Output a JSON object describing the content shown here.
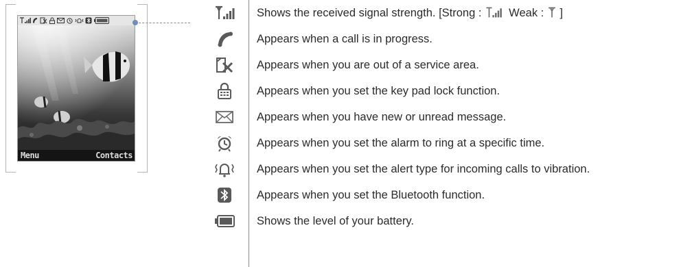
{
  "phone": {
    "softkey_left": "Menu",
    "softkey_right": "Contacts",
    "status_icons": [
      "signal-icon",
      "call-icon",
      "no-service-icon",
      "keypad-lock-icon",
      "message-icon",
      "alarm-icon",
      "vibration-icon",
      "bluetooth-icon",
      "battery-icon"
    ]
  },
  "rows": [
    {
      "icon": "signal-strength-icon",
      "before": "Shows the received signal strength. [Strong : ",
      "middle": "  Weak : ",
      "after": " ]"
    },
    {
      "icon": "call-in-progress-icon",
      "text": "Appears when a call is in progress."
    },
    {
      "icon": "no-service-icon",
      "text": "Appears when you are out of a service area."
    },
    {
      "icon": "keypad-lock-icon",
      "text": "Appears when you set the key pad lock function."
    },
    {
      "icon": "message-envelope-icon",
      "text": "Appears when you have new or unread message."
    },
    {
      "icon": "alarm-clock-icon",
      "text": "Appears when you set the alarm to ring at a specific time."
    },
    {
      "icon": "vibration-icon",
      "text": "Appears when you set the alert type for incoming calls to vibration."
    },
    {
      "icon": "bluetooth-icon",
      "text": "Appears when you set the Bluetooth function."
    },
    {
      "icon": "battery-icon",
      "text": "Shows the level of your battery."
    }
  ],
  "colors": {
    "icon": "#5a5a5a",
    "callout": "#6f8fb8",
    "text": "#2b2b2b"
  }
}
